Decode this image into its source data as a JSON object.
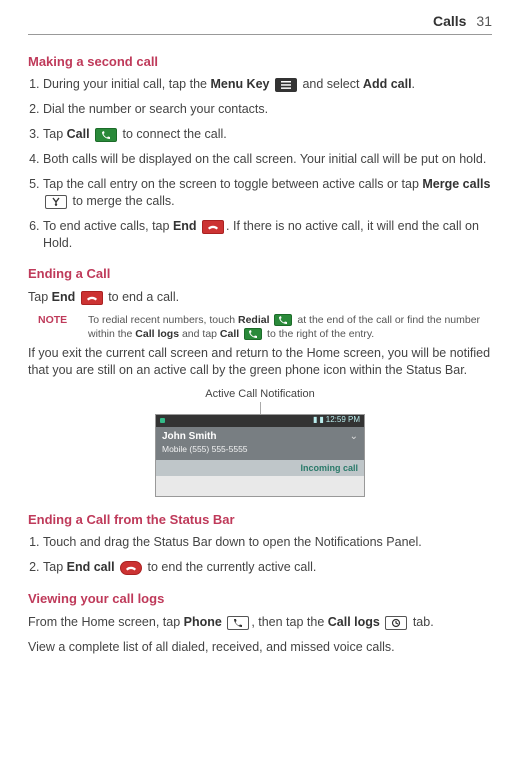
{
  "header": {
    "section": "Calls",
    "page": "31"
  },
  "h_making": "Making a second call",
  "steps_making": [
    {
      "pre": "During your initial call, tap the ",
      "b1": "Menu Key",
      "mid": " ",
      "icon": "menu",
      "post": " and select ",
      "b2": "Add call",
      "tail": "."
    },
    {
      "pre": "Dial the number or search your contacts."
    },
    {
      "pre": "Tap ",
      "b1": "Call",
      "mid": " ",
      "icon": "call-green",
      "post": " to connect the call."
    },
    {
      "pre": "Both calls will be displayed on the call screen. Your initial call will be put on hold."
    },
    {
      "pre": "Tap the call entry on the screen to toggle between active calls or tap ",
      "b1": "Merge calls",
      "mid": " ",
      "icon": "merge",
      "post": " to merge the calls."
    },
    {
      "pre": "To end active calls, tap ",
      "b1": "End",
      "mid": " ",
      "icon": "end-red",
      "post": ". If there is no active call, it will end the call on Hold."
    }
  ],
  "h_ending": "Ending a Call",
  "ending_p": {
    "pre": "Tap ",
    "b1": "End",
    "icon": "end-red",
    "post": " to end a call."
  },
  "note": {
    "label": "NOTE",
    "pre": "To redial recent numbers, touch ",
    "b1": "Redial",
    "icon1": "call-green",
    "mid": " at the end of the call or find the number within the ",
    "b2": "Call logs",
    "mid2": " and tap ",
    "b3": "Call",
    "icon2": "call-green",
    "post": " to the right of the entry."
  },
  "ending_after": "If you exit the current call screen and return to the Home screen, you will be notified that you are still on an active call by the green phone icon within the Status Bar.",
  "fig": {
    "label": "Active Call Notification",
    "time": "12:59 PM",
    "name": "John Smith",
    "number": "Mobile (555) 555-5555",
    "incoming": "Incoming call"
  },
  "h_statusbar": "Ending a Call from the Status Bar",
  "steps_status": [
    {
      "pre": "Touch and drag the Status Bar down to open the Notifications Panel."
    },
    {
      "pre": "Tap ",
      "b1": "End call",
      "mid": " ",
      "icon": "end-red-round",
      "post": " to end the currently active call."
    }
  ],
  "h_viewing": "Viewing your call logs",
  "viewing_p": {
    "pre": "From the Home screen, tap ",
    "b1": "Phone",
    "icon1": "phone-white",
    "mid": ", then tap the ",
    "b2": "Call logs",
    "icon2": "call-logs",
    "post": " tab."
  },
  "viewing_after": "View a complete list of all dialed, received, and missed voice calls."
}
